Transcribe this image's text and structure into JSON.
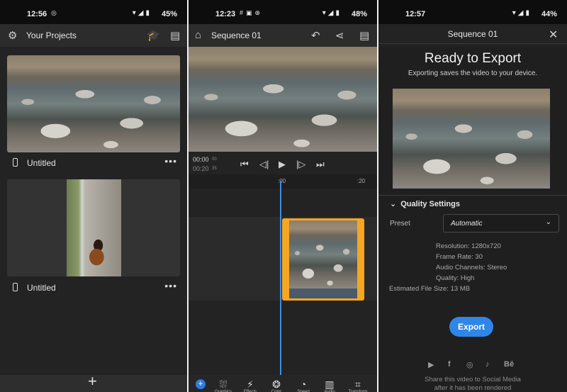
{
  "projects_screen": {
    "status": {
      "time": "12:56",
      "battery": "45%"
    },
    "title": "Your Projects",
    "items": [
      {
        "name": "Untitled"
      },
      {
        "name": "Untitled"
      }
    ],
    "more_label": "•••",
    "add_label": "+"
  },
  "editor_screen": {
    "status": {
      "time": "12:23",
      "battery": "48%"
    },
    "title": "Sequence 01",
    "timecode_current": "00:00",
    "timecode_current_frames": "00",
    "timecode_total": "00:20",
    "timecode_total_frames": "35",
    "ruler_ticks": [
      ":00",
      ":20"
    ],
    "add_label": "+",
    "tools": [
      "Graphics",
      "Effects",
      "Color",
      "Speed",
      "Audio",
      "Transform"
    ]
  },
  "export_screen": {
    "status": {
      "time": "12:57",
      "battery": "44%"
    },
    "title": "Sequence 01",
    "heading": "Ready to Export",
    "subheading": "Exporting saves the video to your device.",
    "quality_header": "Quality Settings",
    "preset_label": "Preset",
    "preset_value": "Automatic",
    "specs": {
      "resolution": "Resolution: 1280x720",
      "frame_rate": "Frame Rate: 30",
      "audio_channels": "Audio Channels: Stereo",
      "quality": "Quality: High",
      "file_size": "Estimated File Size: 13 MB"
    },
    "export_label": "Export",
    "share_line1": "Share this video to Social Media",
    "share_line2": "after it has been rendered",
    "social_icons": [
      "youtube-icon",
      "facebook-icon",
      "instagram-icon",
      "tiktok-icon",
      "behance-icon"
    ],
    "accent": "#2f86e6"
  }
}
